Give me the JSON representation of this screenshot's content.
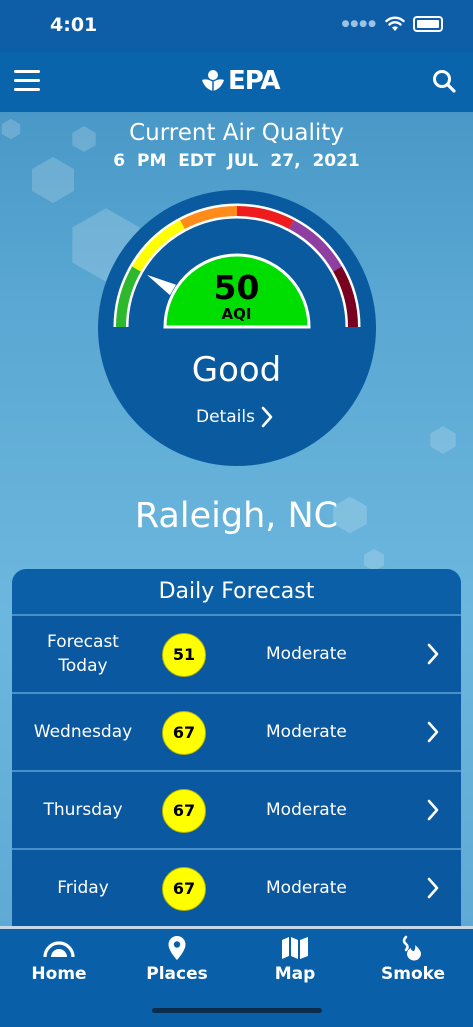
{
  "status_bar": {
    "time": "4:01"
  },
  "header": {
    "logo_text": "EPA"
  },
  "current": {
    "title": "Current Air Quality",
    "time": "6 PM EDT",
    "date": "JUL 27, 2021",
    "aqi": "50",
    "aqi_unit": "AQI",
    "category": "Good",
    "details_label": "Details",
    "aqi_fraction": 0.167
  },
  "location": "Raleigh, NC",
  "forecast": {
    "title": "Daily Forecast",
    "rows": [
      {
        "day": "Forecast Today",
        "aqi": "51",
        "category": "Moderate"
      },
      {
        "day": "Wednesday",
        "aqi": "67",
        "category": "Moderate"
      },
      {
        "day": "Thursday",
        "aqi": "67",
        "category": "Moderate"
      },
      {
        "day": "Friday",
        "aqi": "67",
        "category": "Moderate"
      }
    ]
  },
  "colors": {
    "good": "#2eb82e",
    "moderate": "#ffff00",
    "usg": "#ff8c1a",
    "unhealthy": "#ee1c1c",
    "very_unhealthy": "#8e3fa0",
    "hazardous": "#7a0020",
    "gauge_fill": "#00dd00"
  },
  "tabs": [
    {
      "label": "Home",
      "icon": "gauge-icon"
    },
    {
      "label": "Places",
      "icon": "location-pin-icon"
    },
    {
      "label": "Map",
      "icon": "map-icon"
    },
    {
      "label": "Smoke",
      "icon": "smoke-fire-icon"
    }
  ]
}
